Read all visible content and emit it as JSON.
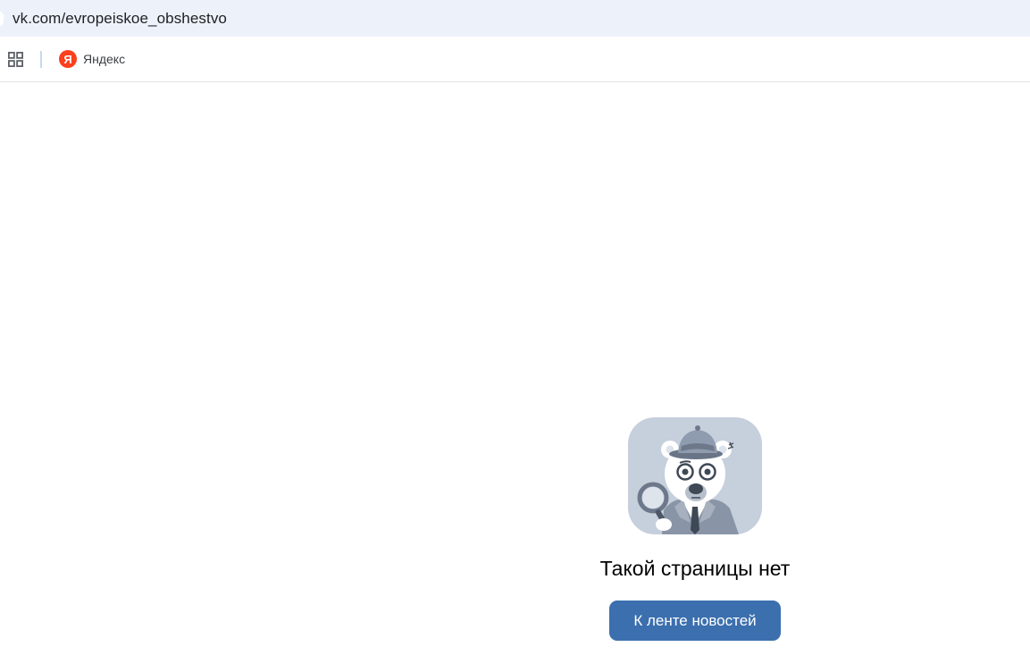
{
  "browser": {
    "address_url": "vk.com/evropeiskoe_obshestvo",
    "bookmarks": [
      {
        "label": "Яндекс",
        "icon": "yandex-logo-icon",
        "icon_letter": "Я",
        "color": "#fc3f1d"
      }
    ],
    "apps_icon": "apps-grid-icon"
  },
  "page": {
    "illustration": "detective-bear-illustration",
    "title": "Такой страницы нет",
    "button_label": "К ленте новостей",
    "button_color": "#3b6fae"
  }
}
